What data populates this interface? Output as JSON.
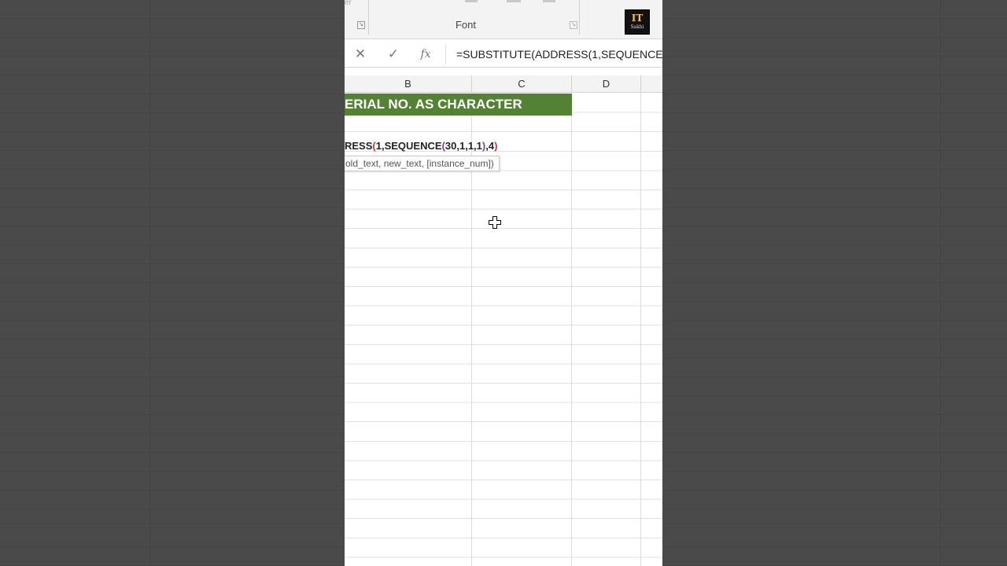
{
  "ribbon": {
    "fragment_text": "er",
    "group_label": "Font"
  },
  "logo": {
    "big": "IT",
    "small": "Sakhi"
  },
  "formula_bar": {
    "cancel_icon": "✕",
    "enter_icon": "✓",
    "fx_icon": "fx",
    "formula": "=SUBSTITUTE(ADDRESS(1,SEQUENCE("
  },
  "columns": [
    "B",
    "C",
    "D"
  ],
  "sheet": {
    "title": "ERIAL NO. AS CHARACTER",
    "edit_prefix": "RESS",
    "edit_paren1": "(",
    "edit_mid1": "1,SEQUENCE",
    "edit_paren2": "(",
    "edit_args": "30,1,1,1",
    "edit_paren3": ")",
    "edit_mid2": ",4",
    "edit_paren4": ")",
    "tooltip": "old_text, new_text, [instance_num])"
  },
  "colors": {
    "header_fill": "#548235",
    "background": "#4a4a4a"
  }
}
